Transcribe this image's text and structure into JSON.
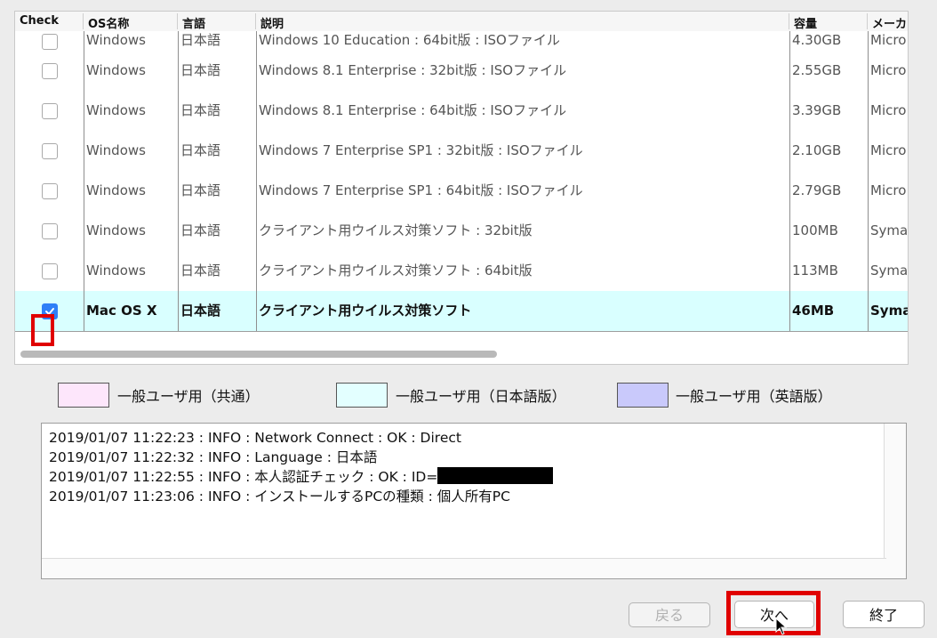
{
  "table": {
    "columns": [
      "Check",
      "OS名称",
      "言語",
      "説明",
      "容量",
      "メーカ"
    ],
    "rows": [
      {
        "checked": false,
        "os": "Windows",
        "lang": "日本語",
        "desc": "Windows 10 Education : 64bit版 : ISOファイル",
        "size": "4.30GB",
        "maker": "Micro"
      },
      {
        "checked": false,
        "os": "Windows",
        "lang": "日本語",
        "desc": "Windows 8.1 Enterprise : 32bit版 : ISOファイル",
        "size": "2.55GB",
        "maker": "Micro"
      },
      {
        "checked": false,
        "os": "Windows",
        "lang": "日本語",
        "desc": "Windows 8.1 Enterprise : 64bit版 : ISOファイル",
        "size": "3.39GB",
        "maker": "Micro"
      },
      {
        "checked": false,
        "os": "Windows",
        "lang": "日本語",
        "desc": "Windows 7 Enterprise SP1 : 32bit版 : ISOファイル",
        "size": "2.10GB",
        "maker": "Micro"
      },
      {
        "checked": false,
        "os": "Windows",
        "lang": "日本語",
        "desc": "Windows 7 Enterprise SP1 : 64bit版 : ISOファイル",
        "size": "2.79GB",
        "maker": "Micro"
      },
      {
        "checked": false,
        "os": "Windows",
        "lang": "日本語",
        "desc": "クライアント用ウイルス対策ソフト : 32bit版",
        "size": "100MB",
        "maker": "Syma"
      },
      {
        "checked": false,
        "os": "Windows",
        "lang": "日本語",
        "desc": "クライアント用ウイルス対策ソフト : 64bit版",
        "size": "113MB",
        "maker": "Syma"
      },
      {
        "checked": true,
        "os": "Mac OS X",
        "lang": "日本語",
        "desc": "クライアント用ウイルス対策ソフト",
        "size": "46MB",
        "maker": "Syma"
      }
    ]
  },
  "legend": [
    {
      "label": "一般ユーザ用（共通）",
      "color": "#fde6fb"
    },
    {
      "label": "一般ユーザ用（日本語版）",
      "color": "#e3ffff"
    },
    {
      "label": "一般ユーザ用（英語版）",
      "color": "#c9c9fb"
    }
  ],
  "log": {
    "lines": [
      "2019/01/07 11:22:23 : INFO : Network Connect : OK : Direct",
      "2019/01/07 11:22:32 : INFO : Language : 日本語",
      "2019/01/07 11:22:55 : INFO : 本人認証チェック : OK : ID=",
      "2019/01/07 11:23:06 : INFO : インストールするPCの種類 : 個人所有PC"
    ]
  },
  "buttons": {
    "back": "戻る",
    "next": "次へ",
    "quit": "終了"
  },
  "colors": {
    "highlight": "#e00000",
    "selected_row": "#d9ffff",
    "checkbox": "#2f7ef7"
  }
}
